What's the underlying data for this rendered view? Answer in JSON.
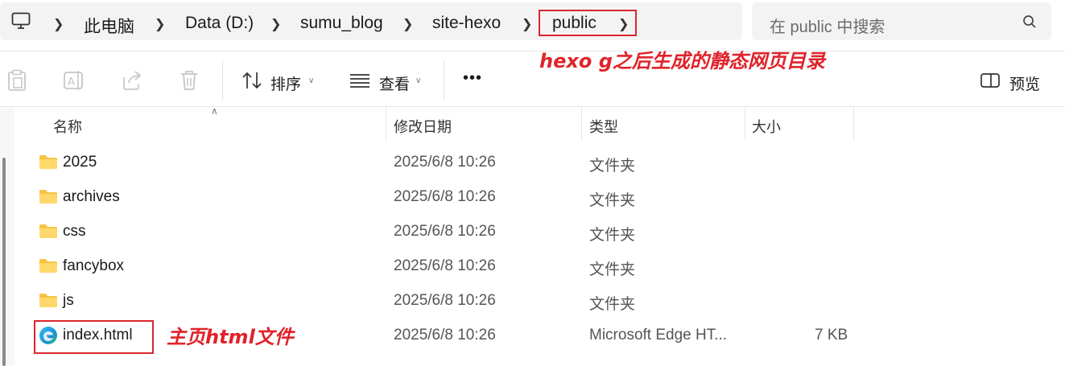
{
  "breadcrumb": {
    "items": [
      "此电脑",
      "Data (D:)",
      "sumu_blog",
      "site-hexo",
      "public"
    ]
  },
  "search": {
    "placeholder": "在 public 中搜索"
  },
  "toolbar": {
    "sort_label": "排序",
    "view_label": "查看",
    "more_label": "•••",
    "preview_label": "预览"
  },
  "columns": {
    "name": "名称",
    "modified": "修改日期",
    "type": "类型",
    "size": "大小"
  },
  "files": [
    {
      "name": "2025",
      "modified": "2025/6/8 10:26",
      "type": "文件夹",
      "size": "",
      "icon": "folder-icon"
    },
    {
      "name": "archives",
      "modified": "2025/6/8 10:26",
      "type": "文件夹",
      "size": "",
      "icon": "folder-icon"
    },
    {
      "name": "css",
      "modified": "2025/6/8 10:26",
      "type": "文件夹",
      "size": "",
      "icon": "folder-icon"
    },
    {
      "name": "fancybox",
      "modified": "2025/6/8 10:26",
      "type": "文件夹",
      "size": "",
      "icon": "folder-icon"
    },
    {
      "name": "js",
      "modified": "2025/6/8 10:26",
      "type": "文件夹",
      "size": "",
      "icon": "folder-icon"
    },
    {
      "name": "index.html",
      "modified": "2025/6/8 10:26",
      "type": "Microsoft Edge HT...",
      "size": "7 KB",
      "icon": "edge-icon"
    }
  ],
  "annotations": {
    "public_note": "hexo g之后生成的静态网页目录",
    "index_note": "主页html文件"
  },
  "colors": {
    "annotation_red": "#d9262b",
    "folder_yellow": "#f6c343"
  }
}
